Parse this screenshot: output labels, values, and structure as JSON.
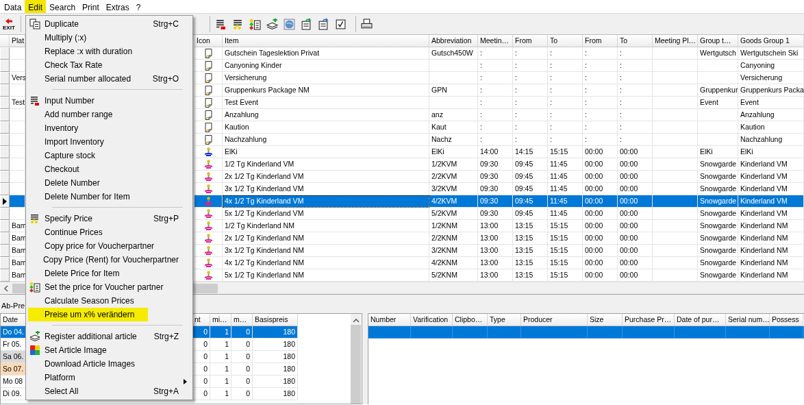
{
  "menubar": [
    {
      "label": "Data",
      "selected": false
    },
    {
      "label": "Edit",
      "selected": true
    },
    {
      "label": "Search",
      "selected": false
    },
    {
      "label": "Print",
      "selected": false
    },
    {
      "label": "Extras",
      "selected": false
    },
    {
      "label": "?",
      "selected": false
    }
  ],
  "toolbar": {
    "exit": {
      "label": "EXIT"
    },
    "tools": [
      {
        "kind": "number-list"
      },
      {
        "kind": "price-list"
      },
      {
        "kind": "voucher-price"
      },
      {
        "kind": "add-article"
      },
      {
        "kind": "image"
      },
      {
        "kind": "copy-green"
      },
      {
        "kind": "copy-blue"
      },
      {
        "kind": "checkbox"
      },
      {
        "kind": "printer"
      }
    ]
  },
  "main_grid": {
    "columns": [
      "Plat",
      "Icon",
      "Item",
      "Abbreviation",
      "Meetin…",
      "From",
      "To",
      "From",
      "To",
      "Meeting Pl…",
      "Group t…",
      "Goods Group 1"
    ],
    "rows": [
      {
        "selected": false,
        "kind": "document",
        "item": "Gutschein Tageslektion Privat",
        "abbreviation": "Gutsch450W",
        "meeting": ":",
        "from_1": ":",
        "to_1": ":",
        "from_2": ":",
        "to_2": ":",
        "group": "Wertgutsch",
        "goods_group": "Wertgutschein Ski"
      },
      {
        "selected": false,
        "kind": "document",
        "item": "Canyoning Kinder",
        "meeting": ":",
        "from_1": ":",
        "to_1": ":",
        "from_2": ":",
        "to_2": ":",
        "goods_group": "Canyoning"
      },
      {
        "selected": false,
        "plat": "Vers",
        "kind": "document",
        "item": "Versicherung",
        "meeting": ":",
        "from_1": ":",
        "to_1": ":",
        "from_2": ":",
        "to_2": ":",
        "goods_group": "Versicherung"
      },
      {
        "selected": false,
        "kind": "document",
        "item": "Gruppenkurs Package NM",
        "abbreviation": "GPN",
        "meeting": ":",
        "from_1": ":",
        "to_1": ":",
        "from_2": ":",
        "to_2": ":",
        "group": "Gruppenkur",
        "goods_group": "Gruppenkurs Packa"
      },
      {
        "selected": false,
        "plat": "Test",
        "kind": "document",
        "item": "Test Event",
        "meeting": ":",
        "from_1": ":",
        "to_1": ":",
        "from_2": ":",
        "to_2": ":",
        "group": "Event",
        "goods_group": "Event"
      },
      {
        "selected": false,
        "kind": "document",
        "item": "Anzahlung",
        "abbreviation": "anz",
        "meeting": ":",
        "from_1": ":",
        "to_1": ":",
        "from_2": ":",
        "to_2": ":",
        "goods_group": "Anzahlung"
      },
      {
        "selected": false,
        "kind": "document",
        "item": "Kaution",
        "abbreviation": "Kaut",
        "meeting": ":",
        "from_1": ":",
        "to_1": ":",
        "from_2": ":",
        "to_2": ":",
        "goods_group": "Kaution"
      },
      {
        "selected": false,
        "kind": "document",
        "item": "Nachzahlung",
        "abbreviation": "Nachz",
        "meeting": ":",
        "from_1": ":",
        "to_1": ":",
        "from_2": ":",
        "to_2": ":",
        "goods_group": "Nachzahlung"
      },
      {
        "selected": false,
        "kind": "figure-blue",
        "item": "ElKi",
        "abbreviation": "ElKi",
        "meeting": "14:00",
        "from_1": "14:15",
        "to_1": "15:15",
        "from_2": "00:00",
        "to_2": "00:00",
        "group": "ElKi",
        "goods_group": "ElKi"
      },
      {
        "selected": false,
        "kind": "figure-pink",
        "item": "1/2 Tg Kinderland VM",
        "abbreviation": "1/2KVM",
        "meeting": "09:30",
        "from_1": "09:45",
        "to_1": "11:45",
        "from_2": "00:00",
        "to_2": "00:00",
        "group": "Snowgarde",
        "goods_group": "Kinderland VM"
      },
      {
        "selected": false,
        "kind": "figure-pink",
        "item": "2x 1/2 Tg Kinderland VM",
        "abbreviation": "2/2KVM",
        "meeting": "09:30",
        "from_1": "09:45",
        "to_1": "11:45",
        "from_2": "00:00",
        "to_2": "00:00",
        "group": "Snowgarde",
        "goods_group": "Kinderland VM"
      },
      {
        "selected": false,
        "kind": "figure-pink",
        "item": "3x 1/2 Tg Kinderland VM",
        "abbreviation": "3/2KVM",
        "meeting": "09:30",
        "from_1": "09:45",
        "to_1": "11:45",
        "from_2": "00:00",
        "to_2": "00:00",
        "group": "Snowgarde",
        "goods_group": "Kinderland VM"
      },
      {
        "selected": true,
        "kind": "figure-pink",
        "item": "4x 1/2 Tg Kinderland VM",
        "abbreviation": "4/2KVM",
        "meeting": "09:30",
        "from_1": "09:45",
        "to_1": "11:45",
        "from_2": "00:00",
        "to_2": "00:00",
        "group": "Snowgarde",
        "goods_group": "Kinderland VM"
      },
      {
        "selected": false,
        "kind": "figure-pink",
        "item": "5x 1/2 Tg Kinderland VM",
        "abbreviation": "5/2KVM",
        "meeting": "09:30",
        "from_1": "09:45",
        "to_1": "11:45",
        "from_2": "00:00",
        "to_2": "00:00",
        "group": "Snowgarde",
        "goods_group": "Kinderland VM"
      },
      {
        "selected": false,
        "plat": "Bam",
        "kind": "figure-pink",
        "item": "1/2 Tg Kinderland NM",
        "abbreviation": "1/2KNM",
        "meeting": "13:00",
        "from_1": "13:15",
        "to_1": "15:15",
        "from_2": "00:00",
        "to_2": "00:00",
        "group": "Snowgarde",
        "goods_group": "Kinderland NM"
      },
      {
        "selected": false,
        "plat": "Bam",
        "kind": "figure-pink",
        "item": "2x 1/2 Tg Kinderland NM",
        "abbreviation": "2/2KNM",
        "meeting": "13:00",
        "from_1": "13:15",
        "to_1": "15:15",
        "from_2": "00:00",
        "to_2": "00:00",
        "group": "Snowgarde",
        "goods_group": "Kinderland NM"
      },
      {
        "selected": false,
        "plat": "Bam",
        "kind": "figure-pink",
        "item": "3x 1/2 Tg Kinderland NM",
        "abbreviation": "3/2KNM",
        "meeting": "13:00",
        "from_1": "13:15",
        "to_1": "15:15",
        "from_2": "00:00",
        "to_2": "00:00",
        "group": "Snowgarde",
        "goods_group": "Kinderland NM"
      },
      {
        "selected": false,
        "plat": "Bam",
        "kind": "figure-pink",
        "item": "4x 1/2 Tg Kinderland NM",
        "abbreviation": "4/2KNM",
        "meeting": "13:00",
        "from_1": "13:15",
        "to_1": "15:15",
        "from_2": "00:00",
        "to_2": "00:00",
        "group": "Snowgarde",
        "goods_group": "Kinderland NM"
      },
      {
        "selected": false,
        "plat": "Bam",
        "kind": "figure-pink",
        "item": "5x 1/2 Tg Kinderland NM",
        "abbreviation": "5/2KNM",
        "meeting": "13:00",
        "from_1": "13:15",
        "to_1": "15:15",
        "from_2": "00:00",
        "to_2": "00:00",
        "group": "Snowgarde",
        "goods_group": "Kinderland NM"
      }
    ]
  },
  "price_label": "Ab-Pre",
  "price_grid": {
    "columns": [
      "Date",
      "nt",
      "mi…",
      "m…",
      "Basispreis"
    ],
    "rows": [
      {
        "selected": true,
        "cells": [
          "Do 04.",
          "0",
          "1",
          "0",
          "180"
        ]
      },
      {
        "selected": false,
        "kind": "weekday",
        "cells": [
          "Fr 05.",
          "0",
          "1",
          "0",
          "180"
        ]
      },
      {
        "selected": false,
        "kind": "saturday",
        "cells": [
          "Sa 06.",
          "0",
          "1",
          "0",
          "180"
        ]
      },
      {
        "selected": false,
        "kind": "sunday",
        "cells": [
          "So 07.",
          "0",
          "1",
          "0",
          "180"
        ]
      },
      {
        "selected": false,
        "kind": "weekday",
        "cells": [
          "Mo 08",
          "0",
          "1",
          "0",
          "180"
        ]
      },
      {
        "selected": false,
        "kind": "weekday",
        "cells": [
          "Di 09.",
          "0",
          "1",
          "0",
          "180"
        ]
      }
    ]
  },
  "number_grid": {
    "columns": [
      "Number",
      "Varification",
      "Clipbo…",
      "Type",
      "Producer",
      "Size",
      "Purchase Pr…",
      "Date of pur…",
      "Serial num…",
      "Possess"
    ],
    "rows": [
      {
        "selected": true
      }
    ]
  },
  "edit_menu": {
    "groups": [
      [
        {
          "label": "Duplicate",
          "shortcut": "Strg+C",
          "kind": "duplicate",
          "highlighted": false,
          "submenu": false
        },
        {
          "label": "Multiply (:x)",
          "highlighted": false,
          "submenu": false
        },
        {
          "label": "Replace :x with duration",
          "highlighted": false,
          "submenu": false
        },
        {
          "label": "Check Tax Rate",
          "highlighted": false,
          "submenu": false
        },
        {
          "label": "Serial number allocated",
          "shortcut": "Strg+O",
          "highlighted": false,
          "submenu": false
        }
      ],
      [
        {
          "label": "Input Number",
          "kind": "number-list",
          "highlighted": false,
          "submenu": false
        },
        {
          "label": "Add number range",
          "highlighted": false,
          "submenu": false
        },
        {
          "label": "Inventory",
          "highlighted": false,
          "submenu": false
        },
        {
          "label": "Import Inventory",
          "highlighted": false,
          "submenu": false
        },
        {
          "label": "Capture stock",
          "highlighted": false,
          "submenu": false
        },
        {
          "label": "Checkout",
          "highlighted": false,
          "submenu": false
        },
        {
          "label": "Delete Number",
          "highlighted": false,
          "submenu": false
        },
        {
          "label": "Delete Number for Item",
          "highlighted": false,
          "submenu": false
        }
      ],
      [
        {
          "label": "Specify Price",
          "shortcut": "Strg+P",
          "kind": "price-list",
          "highlighted": false,
          "submenu": false
        },
        {
          "label": "Continue Prices",
          "highlighted": false,
          "submenu": false
        },
        {
          "label": "Copy price for Voucherpartner",
          "highlighted": false,
          "submenu": false
        },
        {
          "label": "Copy Price (Rent) for Voucherpartner",
          "highlighted": false,
          "submenu": false
        },
        {
          "label": "Delete Price for Item",
          "highlighted": false,
          "submenu": false
        },
        {
          "label": "Set the price for Voucher partner",
          "kind": "voucher-price",
          "highlighted": false,
          "submenu": false
        },
        {
          "label": "Calculate Season Prices",
          "highlighted": false,
          "submenu": false
        },
        {
          "label": "Preise um x% verändern",
          "highlighted": true,
          "submenu": false
        }
      ],
      [
        {
          "label": "Register additional article",
          "shortcut": "Strg+Z",
          "kind": "add-article",
          "highlighted": false,
          "submenu": false
        },
        {
          "label": "Set Article Image",
          "kind": "color-image",
          "highlighted": false,
          "submenu": false
        },
        {
          "label": "Download Article Images",
          "highlighted": false,
          "submenu": false
        },
        {
          "label": "Platform",
          "highlighted": false,
          "submenu": true
        },
        {
          "label": "Select All",
          "shortcut": "Strg+A",
          "highlighted": false,
          "submenu": false
        }
      ]
    ]
  }
}
